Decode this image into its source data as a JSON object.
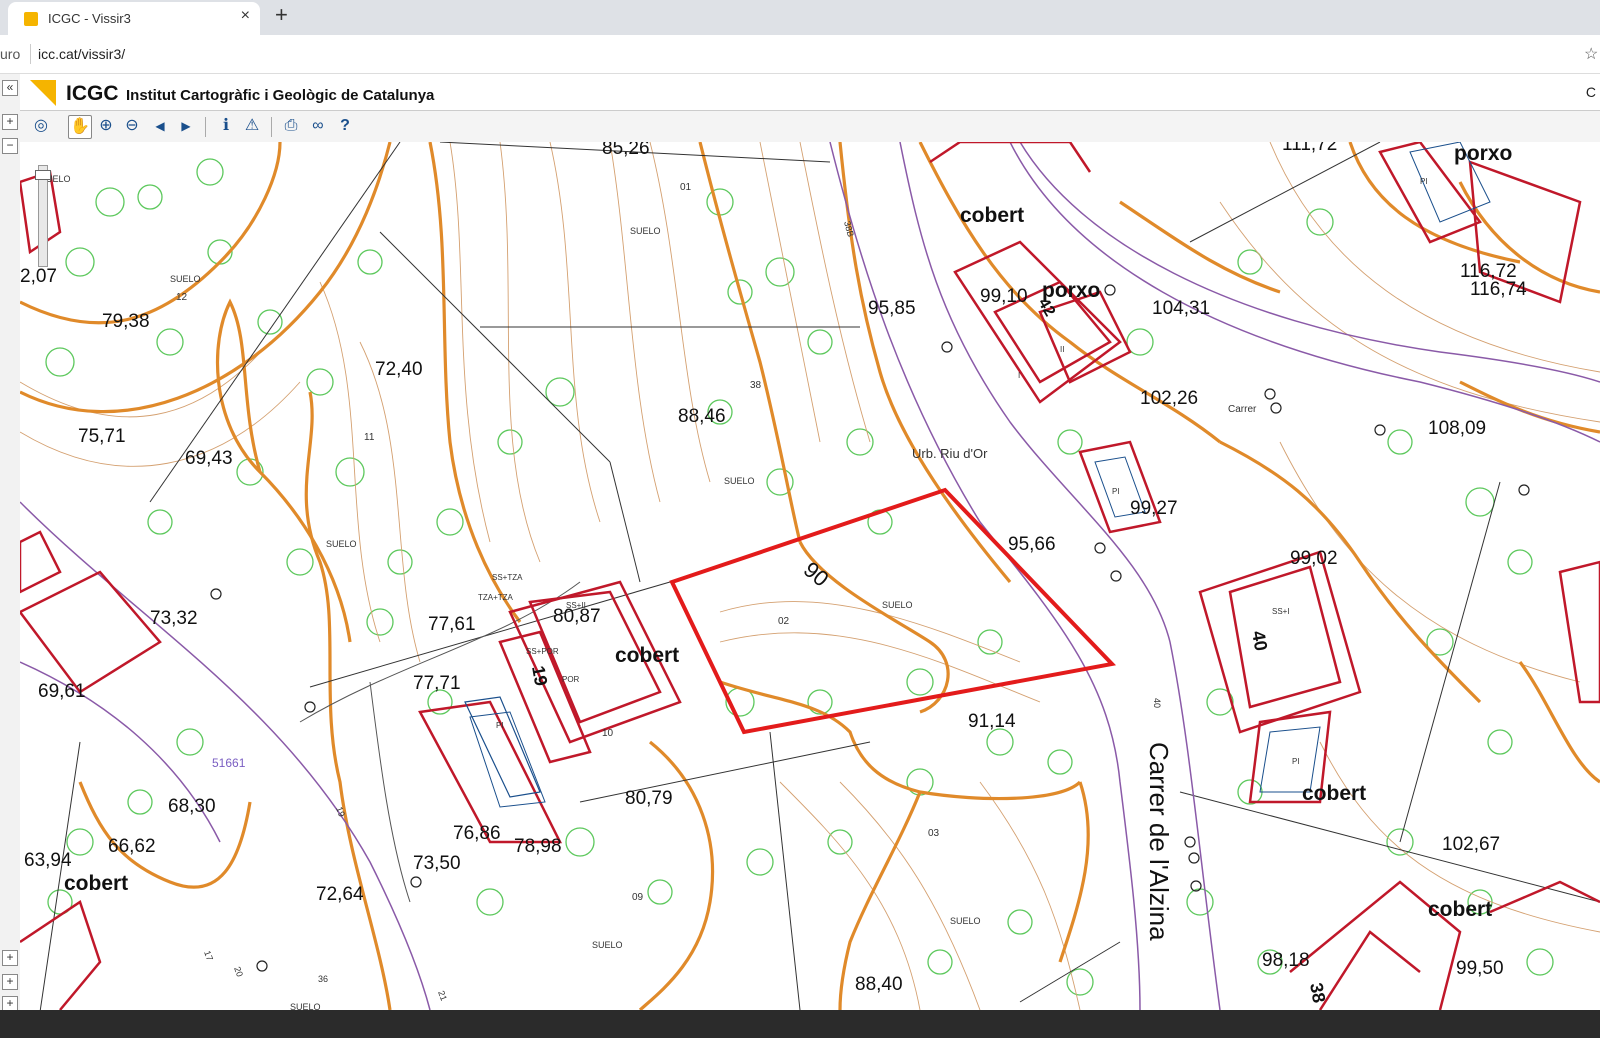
{
  "browser": {
    "tab_title": "ICGC - Vissir3",
    "tab_close": "×",
    "new_tab": "+",
    "address_prefix": "uro",
    "url": "icc.cat/vissir3/"
  },
  "app": {
    "short_name": "ICGC",
    "full_name": "Institut Cartogràfic i Geològic de Catalunya",
    "header_right": "C"
  },
  "left_strip": {
    "collapse": "«",
    "plus_top": "+",
    "minus_top": "−",
    "plus_bottom_a": "+",
    "plus_bottom_b": "+",
    "plus_bottom_c": "+"
  },
  "toolbar": {
    "tools": [
      {
        "name": "globe-search-icon",
        "glyph": "◎"
      },
      {
        "name": "pan-hand-icon",
        "glyph": "✋"
      },
      {
        "name": "zoom-in-icon",
        "glyph": "⊕"
      },
      {
        "name": "zoom-out-icon",
        "glyph": "⊖"
      },
      {
        "name": "back-arrow-icon",
        "glyph": "◀"
      },
      {
        "name": "forward-arrow-icon",
        "glyph": "▶"
      },
      {
        "name": "info-icon",
        "glyph": "ℹ"
      },
      {
        "name": "warning-icon",
        "glyph": "⚠"
      },
      {
        "name": "print-icon",
        "glyph": "⎙"
      },
      {
        "name": "link-icon",
        "glyph": "∞"
      },
      {
        "name": "help-icon",
        "glyph": "?"
      }
    ]
  },
  "map": {
    "highlight_color": "#e31b1b",
    "building_color": "#c0182a",
    "contour_color": "#e08a2a",
    "vegetation_color": "#5cc85c",
    "parcel_line_color": "#333333",
    "street_label": "Carrer de l'Alzina",
    "plot_contour_label": "90",
    "labels": [
      "85,26",
      "79,38",
      "72,40",
      "75,71",
      "69,43",
      "2,07",
      "88,46",
      "95,85",
      "99,10",
      "104,31",
      "102,26",
      "108,09",
      "116,72",
      "116,74",
      "99,27",
      "95,66",
      "99,02",
      "73,32",
      "77,61",
      "80,87",
      "77,71",
      "69,61",
      "91,14",
      "68,30",
      "66,62",
      "63,94",
      "80,79",
      "76,86",
      "78,98",
      "73,50",
      "72,64",
      "102,67",
      "98,18",
      "99,50",
      "88,40",
      "111,72"
    ],
    "cobert_labels": [
      "cobert",
      "cobert",
      "cobert",
      "cobert",
      "cobert"
    ],
    "porxo_labels": [
      "porxo",
      "porxo"
    ],
    "small_labels": [
      "SUELO",
      "SUELO",
      "SUELO",
      "SUELO",
      "SUELO",
      "SUELO",
      "SUELO",
      "SUELO",
      "SUELO",
      "Urb. Riu d'Or",
      "Carrer",
      "12",
      "11",
      "01",
      "38",
      "02",
      "03",
      "09",
      "10",
      "19",
      "40",
      "38",
      "42",
      "51661",
      "POR",
      "PI",
      "PI",
      "PI",
      "PI",
      "SS+II",
      "SS+POR",
      "SS+I",
      "SS+TZA",
      "TZA+TZA",
      "II",
      "I",
      "19",
      "17",
      "20",
      "21",
      "36",
      "40",
      "38B"
    ]
  }
}
